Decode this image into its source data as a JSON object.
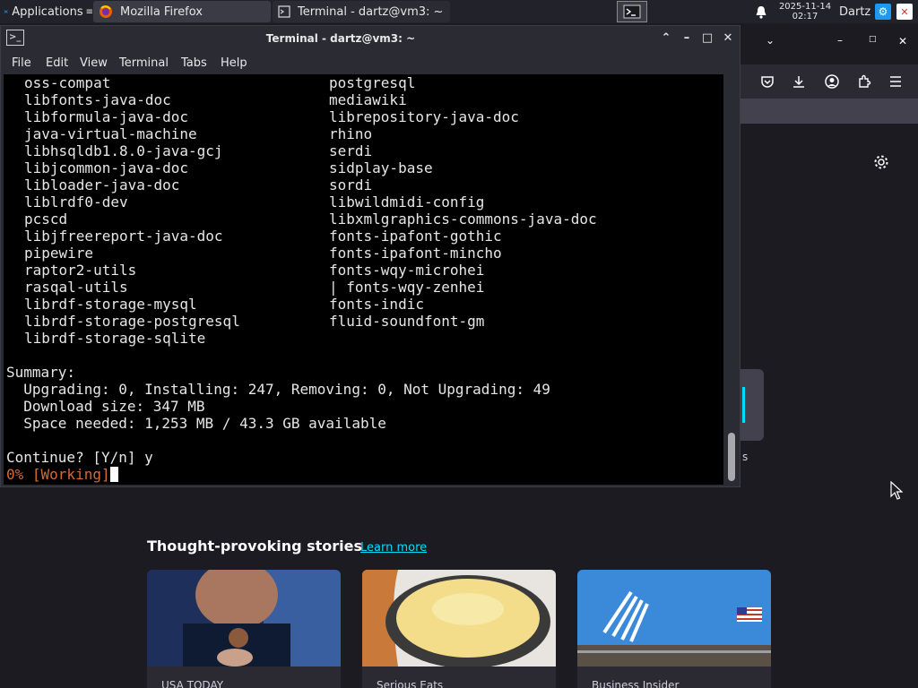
{
  "panel": {
    "applications_label": "Applications",
    "tasks": [
      {
        "label": "Mozilla Firefox",
        "icon": "firefox-icon"
      },
      {
        "label": "Terminal - dartz@vm3: ~",
        "icon": "terminal-icon"
      }
    ],
    "clock_date": "2025-11-14",
    "clock_time": "02:17",
    "user": "Dartz"
  },
  "terminal": {
    "title": "Terminal - dartz@vm3: ~",
    "menu": [
      "File",
      "Edit",
      "View",
      "Terminal",
      "Tabs",
      "Help"
    ],
    "packages_left": [
      "oss-compat",
      "libfonts-java-doc",
      "libformula-java-doc",
      "java-virtual-machine",
      "libhsqldb1.8.0-java-gcj",
      "libjcommon-java-doc",
      "libloader-java-doc",
      "liblrdf0-dev",
      "pcscd",
      "libjfreereport-java-doc",
      "pipewire",
      "raptor2-utils",
      "rasqal-utils",
      "librdf-storage-mysql",
      "librdf-storage-postgresql",
      "librdf-storage-sqlite"
    ],
    "packages_right": [
      "postgresql",
      "mediawiki",
      "librepository-java-doc",
      "rhino",
      "serdi",
      "sidplay-base",
      "sordi",
      "libwildmidi-config",
      "libxmlgraphics-commons-java-doc",
      "fonts-ipafont-gothic",
      "fonts-ipafont-mincho",
      "fonts-wqy-microhei",
      "| fonts-wqy-zenhei",
      "fonts-indic",
      "fluid-soundfont-gm"
    ],
    "summary_header": "Summary:",
    "summary_counts": "  Upgrading: 0, Installing: 247, Removing: 0, Not Upgrading: 49",
    "download_size": "  Download size: 347 MB",
    "space_needed": "  Space needed: 1,253 MB / 43.3 GB available",
    "prompt": "Continue? [Y/n] y",
    "progress": "0% [Working]"
  },
  "firefox": {
    "stories_title": "Thought-provoking stories",
    "learn_more": "Learn more",
    "shortcut_label_fragment": "s",
    "cards": [
      {
        "source": "USA TODAY"
      },
      {
        "source": "Serious Eats"
      },
      {
        "source": "Business Insider"
      }
    ]
  },
  "colors": {
    "panel_bg": "#22232a",
    "terminal_bg": "#000000",
    "progress_text": "#d8692f",
    "link": "#00ddff",
    "firefox_bg": "#1c1b22"
  }
}
